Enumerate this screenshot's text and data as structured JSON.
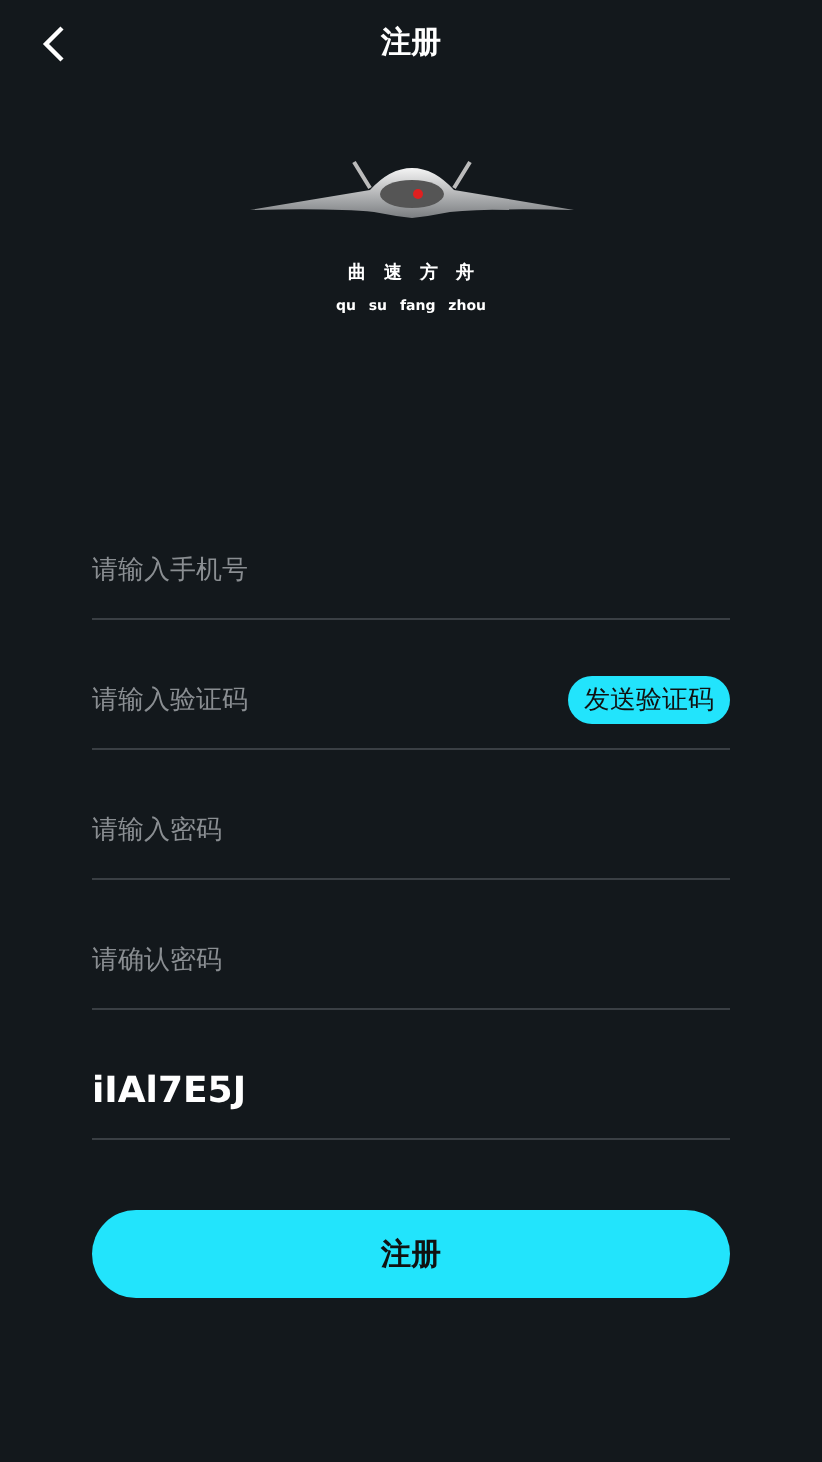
{
  "header": {
    "back_icon": true,
    "title": "注册"
  },
  "logo": {
    "name": "曲 速 方 舟",
    "pinyin": "qu su fang zhou"
  },
  "fields": [
    {
      "kind": "input",
      "placeholder": "请输入手机号"
    },
    {
      "kind": "code",
      "placeholder": "请输入验证码",
      "button": "发送验证码"
    },
    {
      "kind": "input",
      "placeholder": "请输入密码"
    },
    {
      "kind": "input",
      "placeholder": "请确认密码"
    },
    {
      "kind": "captcha",
      "value": "iIAl7E5J"
    }
  ],
  "submit": "注册"
}
